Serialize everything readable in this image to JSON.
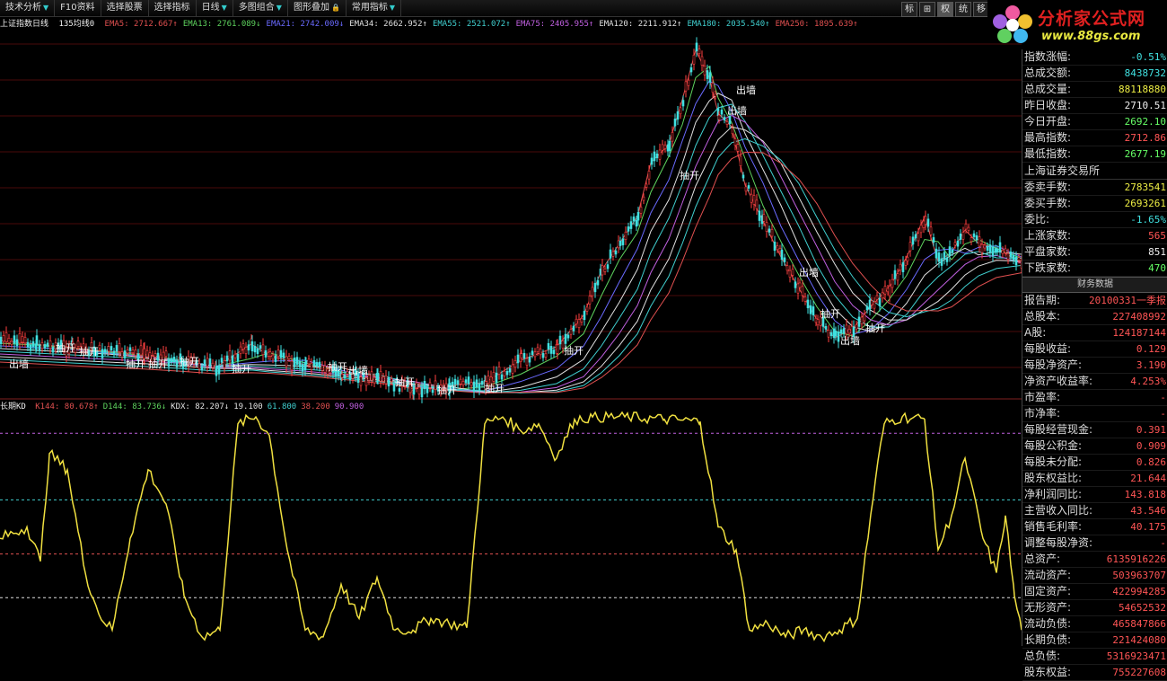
{
  "toolbar": {
    "buttons": [
      "技术分析",
      "F10资料",
      "选择股票",
      "选择指标",
      "日线",
      "多图组合",
      "图形叠加",
      "常用指标"
    ],
    "right_buttons": [
      "标",
      "⊞",
      "权",
      "统",
      "移"
    ]
  },
  "logo": {
    "title": "分析家公式网",
    "url": "www.88gs.com"
  },
  "main_legend": {
    "title": "上证指数日线",
    "subtitle": "135均线0",
    "items": [
      {
        "text": "EMA5: 2712.667↑",
        "color": "#e05050"
      },
      {
        "text": "EMA13: 2761.089↓",
        "color": "#5ed35e"
      },
      {
        "text": "EMA21: 2742.009↓",
        "color": "#6a6aff"
      },
      {
        "text": "EMA34: 2662.952↑",
        "color": "#e0e0e0"
      },
      {
        "text": "EMA55: 2521.072↑",
        "color": "#40d0d0"
      },
      {
        "text": "EMA75: 2405.955↑",
        "color": "#c060e0"
      },
      {
        "text": "EMA120: 2211.912↑",
        "color": "#e0e0e0"
      },
      {
        "text": "EMA180: 2035.540↑",
        "color": "#40d0d0"
      },
      {
        "text": "EMA250: 1895.639↑",
        "color": "#e05050"
      }
    ]
  },
  "kd_legend": {
    "title": "长期KD",
    "items": [
      {
        "text": "K144: 80.678↑",
        "color": "#e05050"
      },
      {
        "text": "D144: 83.736↓",
        "color": "#5ed35e"
      },
      {
        "text": "KDX: 82.207↓",
        "color": "#e0e0e0"
      },
      {
        "text": "19.100",
        "color": "#e0e0e0"
      },
      {
        "text": "61.800",
        "color": "#40d0d0"
      },
      {
        "text": "38.200",
        "color": "#e05050"
      },
      {
        "text": "90.900",
        "color": "#c060e0"
      }
    ]
  },
  "chart_labels": [
    "出墙",
    "抽开",
    "抽开",
    "抽开",
    "抽开",
    "抽开",
    "抽开",
    "抽开",
    "出墙",
    "抽开",
    "抽开",
    "抽开",
    "抽开",
    "抽开",
    "出墙",
    "出墙",
    "出墙",
    "抽开",
    "出墙",
    "抽开"
  ],
  "quote": {
    "rows": [
      {
        "label": "指数涨幅:",
        "value": "-0.51%",
        "color": "cyan"
      },
      {
        "label": "总成交额:",
        "value": "8438732",
        "color": "cyan"
      },
      {
        "label": "总成交量:",
        "value": "88118880",
        "color": "yellow"
      },
      {
        "label": "昨日收盘:",
        "value": "2710.51",
        "color": "white"
      },
      {
        "label": "今日开盘:",
        "value": "2692.10",
        "color": "green"
      },
      {
        "label": "最高指数:",
        "value": "2712.86",
        "color": "red"
      },
      {
        "label": "最低指数:",
        "value": "2677.19",
        "color": "green"
      }
    ],
    "exchange": "上海证券交易所",
    "rows2": [
      {
        "label": "委卖手数:",
        "value": "2783541",
        "color": "yellow"
      },
      {
        "label": "委买手数:",
        "value": "2693261",
        "color": "yellow"
      },
      {
        "label": "委比:",
        "value": "-1.65%",
        "color": "cyan"
      },
      {
        "label": "上涨家数:",
        "value": "565",
        "color": "red"
      },
      {
        "label": "平盘家数:",
        "value": "851",
        "color": "white"
      },
      {
        "label": "下跌家数:",
        "value": "470",
        "color": "green"
      }
    ]
  },
  "finance": {
    "title": "财务数据",
    "rows": [
      {
        "label": "报告期:",
        "value": "20100331一季报",
        "color": "red"
      },
      {
        "label": "总股本:",
        "value": "227408992",
        "color": "red"
      },
      {
        "label": "A股:",
        "value": "124187144",
        "color": "red"
      },
      {
        "label": "每股收益:",
        "value": "0.129",
        "color": "red"
      },
      {
        "label": "每股净资产:",
        "value": "3.190",
        "color": "red"
      },
      {
        "label": "净资产收益率:",
        "value": "4.253%",
        "color": "red"
      },
      {
        "label": "市盈率:",
        "value": "-",
        "color": "red"
      },
      {
        "label": "市净率:",
        "value": "-",
        "color": "red"
      },
      {
        "label": "每股经营现金:",
        "value": "0.391",
        "color": "red"
      },
      {
        "label": "每股公积金:",
        "value": "0.909",
        "color": "red"
      },
      {
        "label": "每股未分配:",
        "value": "0.826",
        "color": "red"
      },
      {
        "label": "股东权益比:",
        "value": "21.644",
        "color": "red"
      },
      {
        "label": "净利润同比:",
        "value": "143.818",
        "color": "red"
      },
      {
        "label": "主营收入同比:",
        "value": "43.546",
        "color": "red"
      },
      {
        "label": "销售毛利率:",
        "value": "40.175",
        "color": "red"
      },
      {
        "label": "调整每股净资:",
        "value": "-",
        "color": "red"
      },
      {
        "label": "总资产:",
        "value": "6135916226",
        "color": "red"
      },
      {
        "label": "流动资产:",
        "value": "503963707",
        "color": "red"
      },
      {
        "label": "固定资产:",
        "value": "422994285",
        "color": "red"
      },
      {
        "label": "无形资产:",
        "value": "54652532",
        "color": "red"
      },
      {
        "label": "流动负债:",
        "value": "465847866",
        "color": "red"
      },
      {
        "label": "长期负债:",
        "value": "221424080",
        "color": "red"
      },
      {
        "label": "总负债:",
        "value": "5316923471",
        "color": "red"
      },
      {
        "label": "股东权益:",
        "value": "755227608",
        "color": "red"
      }
    ]
  }
}
